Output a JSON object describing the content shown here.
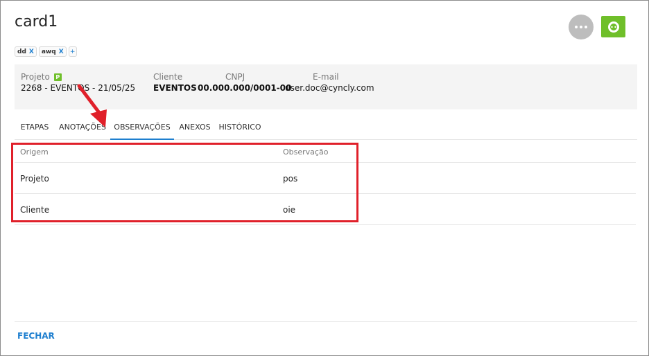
{
  "card": {
    "title": "card1"
  },
  "tags": [
    {
      "label": "dd",
      "remove": "X"
    },
    {
      "label": "awq",
      "remove": "X"
    }
  ],
  "tag_add": "+",
  "info": {
    "projeto_label": "Projeto",
    "projeto_badge": "P",
    "projeto_value": "2268 - EVENTOS - 21/05/25",
    "cliente_label": "Cliente",
    "cliente_value": "EVENTOS",
    "cnpj_label": "CNPJ",
    "cnpj_value": "00.000.000/0001-00",
    "email_label": "E-mail",
    "email_value": "user.doc@cyncly.com"
  },
  "tabs": [
    {
      "label": "ETAPAS",
      "active": false
    },
    {
      "label": "ANOTAÇÕES",
      "active": false
    },
    {
      "label": "OBSERVAÇÕES",
      "active": true
    },
    {
      "label": "ANEXOS",
      "active": false
    },
    {
      "label": "HISTÓRICO",
      "active": false
    }
  ],
  "table": {
    "headers": [
      "Origem",
      "Observação"
    ],
    "rows": [
      [
        "Projeto",
        "pos"
      ],
      [
        "Cliente",
        "oie"
      ]
    ]
  },
  "footer": {
    "close_label": "FECHAR"
  },
  "colors": {
    "accent": "#1e7fcf",
    "whatsapp": "#6fbf2a",
    "highlight": "#e0202a"
  }
}
